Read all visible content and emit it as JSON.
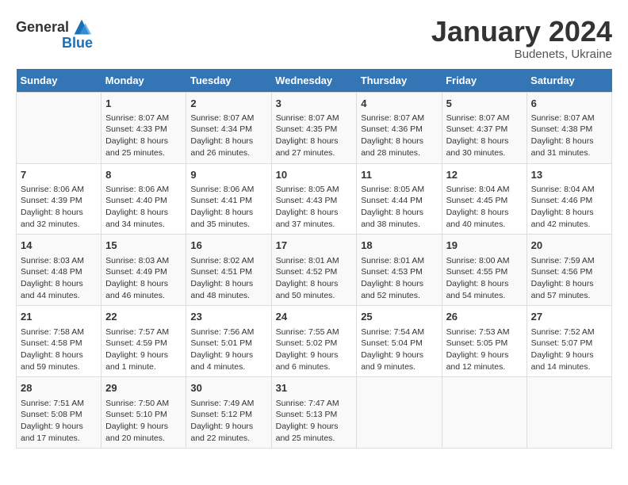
{
  "header": {
    "logo_general": "General",
    "logo_blue": "Blue",
    "month_title": "January 2024",
    "subtitle": "Budenets, Ukraine"
  },
  "columns": [
    "Sunday",
    "Monday",
    "Tuesday",
    "Wednesday",
    "Thursday",
    "Friday",
    "Saturday"
  ],
  "weeks": [
    [
      {
        "day": "",
        "info": ""
      },
      {
        "day": "1",
        "info": "Sunrise: 8:07 AM\nSunset: 4:33 PM\nDaylight: 8 hours\nand 25 minutes."
      },
      {
        "day": "2",
        "info": "Sunrise: 8:07 AM\nSunset: 4:34 PM\nDaylight: 8 hours\nand 26 minutes."
      },
      {
        "day": "3",
        "info": "Sunrise: 8:07 AM\nSunset: 4:35 PM\nDaylight: 8 hours\nand 27 minutes."
      },
      {
        "day": "4",
        "info": "Sunrise: 8:07 AM\nSunset: 4:36 PM\nDaylight: 8 hours\nand 28 minutes."
      },
      {
        "day": "5",
        "info": "Sunrise: 8:07 AM\nSunset: 4:37 PM\nDaylight: 8 hours\nand 30 minutes."
      },
      {
        "day": "6",
        "info": "Sunrise: 8:07 AM\nSunset: 4:38 PM\nDaylight: 8 hours\nand 31 minutes."
      }
    ],
    [
      {
        "day": "7",
        "info": "Sunrise: 8:06 AM\nSunset: 4:39 PM\nDaylight: 8 hours\nand 32 minutes."
      },
      {
        "day": "8",
        "info": "Sunrise: 8:06 AM\nSunset: 4:40 PM\nDaylight: 8 hours\nand 34 minutes."
      },
      {
        "day": "9",
        "info": "Sunrise: 8:06 AM\nSunset: 4:41 PM\nDaylight: 8 hours\nand 35 minutes."
      },
      {
        "day": "10",
        "info": "Sunrise: 8:05 AM\nSunset: 4:43 PM\nDaylight: 8 hours\nand 37 minutes."
      },
      {
        "day": "11",
        "info": "Sunrise: 8:05 AM\nSunset: 4:44 PM\nDaylight: 8 hours\nand 38 minutes."
      },
      {
        "day": "12",
        "info": "Sunrise: 8:04 AM\nSunset: 4:45 PM\nDaylight: 8 hours\nand 40 minutes."
      },
      {
        "day": "13",
        "info": "Sunrise: 8:04 AM\nSunset: 4:46 PM\nDaylight: 8 hours\nand 42 minutes."
      }
    ],
    [
      {
        "day": "14",
        "info": "Sunrise: 8:03 AM\nSunset: 4:48 PM\nDaylight: 8 hours\nand 44 minutes."
      },
      {
        "day": "15",
        "info": "Sunrise: 8:03 AM\nSunset: 4:49 PM\nDaylight: 8 hours\nand 46 minutes."
      },
      {
        "day": "16",
        "info": "Sunrise: 8:02 AM\nSunset: 4:51 PM\nDaylight: 8 hours\nand 48 minutes."
      },
      {
        "day": "17",
        "info": "Sunrise: 8:01 AM\nSunset: 4:52 PM\nDaylight: 8 hours\nand 50 minutes."
      },
      {
        "day": "18",
        "info": "Sunrise: 8:01 AM\nSunset: 4:53 PM\nDaylight: 8 hours\nand 52 minutes."
      },
      {
        "day": "19",
        "info": "Sunrise: 8:00 AM\nSunset: 4:55 PM\nDaylight: 8 hours\nand 54 minutes."
      },
      {
        "day": "20",
        "info": "Sunrise: 7:59 AM\nSunset: 4:56 PM\nDaylight: 8 hours\nand 57 minutes."
      }
    ],
    [
      {
        "day": "21",
        "info": "Sunrise: 7:58 AM\nSunset: 4:58 PM\nDaylight: 8 hours\nand 59 minutes."
      },
      {
        "day": "22",
        "info": "Sunrise: 7:57 AM\nSunset: 4:59 PM\nDaylight: 9 hours\nand 1 minute."
      },
      {
        "day": "23",
        "info": "Sunrise: 7:56 AM\nSunset: 5:01 PM\nDaylight: 9 hours\nand 4 minutes."
      },
      {
        "day": "24",
        "info": "Sunrise: 7:55 AM\nSunset: 5:02 PM\nDaylight: 9 hours\nand 6 minutes."
      },
      {
        "day": "25",
        "info": "Sunrise: 7:54 AM\nSunset: 5:04 PM\nDaylight: 9 hours\nand 9 minutes."
      },
      {
        "day": "26",
        "info": "Sunrise: 7:53 AM\nSunset: 5:05 PM\nDaylight: 9 hours\nand 12 minutes."
      },
      {
        "day": "27",
        "info": "Sunrise: 7:52 AM\nSunset: 5:07 PM\nDaylight: 9 hours\nand 14 minutes."
      }
    ],
    [
      {
        "day": "28",
        "info": "Sunrise: 7:51 AM\nSunset: 5:08 PM\nDaylight: 9 hours\nand 17 minutes."
      },
      {
        "day": "29",
        "info": "Sunrise: 7:50 AM\nSunset: 5:10 PM\nDaylight: 9 hours\nand 20 minutes."
      },
      {
        "day": "30",
        "info": "Sunrise: 7:49 AM\nSunset: 5:12 PM\nDaylight: 9 hours\nand 22 minutes."
      },
      {
        "day": "31",
        "info": "Sunrise: 7:47 AM\nSunset: 5:13 PM\nDaylight: 9 hours\nand 25 minutes."
      },
      {
        "day": "",
        "info": ""
      },
      {
        "day": "",
        "info": ""
      },
      {
        "day": "",
        "info": ""
      }
    ]
  ]
}
